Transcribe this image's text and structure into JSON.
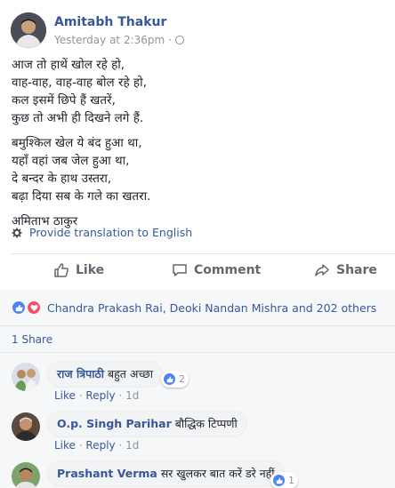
{
  "post": {
    "author": "Amitabh Thakur",
    "timestamp": "Yesterday at 2:36pm",
    "separator": "·",
    "stanzas": [
      [
        "आज तो हाथें खोल रहे हो,",
        "वाह-वाह, वाह-वाह बोल रहे हो,",
        "कल इसमें छिपे हैं खतरें,",
        "कुछ तो अभी ही दिखने लगे हैं."
      ],
      [
        "बमुश्किल खेल ये बंद हुआ था,",
        "यहाँ वहां जब जेल हुआ था,",
        "दे बन्दर के हाथ उस्तरा,",
        "बढ़ा दिया सब के गले का खतरा."
      ],
      [
        "अमिताभ ठाकुर"
      ]
    ],
    "translate_label": "Provide translation to English"
  },
  "actions": {
    "like_label": "Like",
    "comment_label": "Comment",
    "share_label": "Share"
  },
  "reactions": {
    "summary": "Chandra Prakash Rai, Deoki Nandan Mishra and 202 others",
    "shares": "1 Share"
  },
  "comments": [
    {
      "name": "राज त्रिपाठी",
      "text": "बहुत अच्छा",
      "reaction_count": "2",
      "like": "Like",
      "reply": "Reply",
      "age": "1d"
    },
    {
      "name": "O.p. Singh Parihar",
      "text": "बौद्धिक टिप्पणी",
      "reaction_count": "",
      "like": "Like",
      "reply": "Reply",
      "age": "1d"
    },
    {
      "name": "Prashant Verma",
      "text": "सर खुलकर बात करें डरे नहीं",
      "reaction_count": "1",
      "like": "",
      "reply": "",
      "age": ""
    }
  ],
  "colors": {
    "link": "#365899",
    "muted": "#90949c",
    "like_blue": "#4f85f0",
    "love_red": "#f25268"
  },
  "icons": [
    "globe-icon",
    "gear-icon",
    "thumbs-up-icon",
    "comment-icon",
    "share-arrow-icon",
    "like-reaction-icon",
    "love-reaction-icon"
  ]
}
